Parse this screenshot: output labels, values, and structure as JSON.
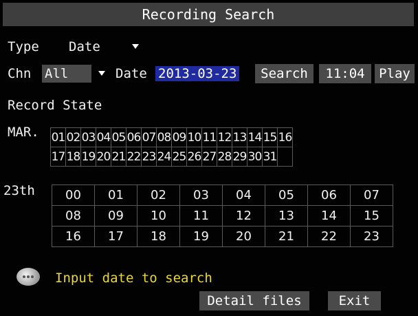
{
  "title": "Recording Search",
  "type_row": {
    "label": "Type",
    "value": "Date"
  },
  "filter_row": {
    "chn_label": "Chn",
    "chn_value": "All",
    "date_label": "Date",
    "date_value": "2013-03-23",
    "search_label": "Search",
    "time_value": "11:04",
    "play_label": "Play"
  },
  "record_state_label": "Record State",
  "month": {
    "label": "MAR.",
    "days": [
      "01",
      "02",
      "03",
      "04",
      "05",
      "06",
      "07",
      "08",
      "09",
      "10",
      "11",
      "12",
      "13",
      "14",
      "15",
      "16",
      "17",
      "18",
      "19",
      "20",
      "21",
      "22",
      "23",
      "24",
      "25",
      "26",
      "27",
      "28",
      "29",
      "30",
      "31",
      ""
    ]
  },
  "hours": {
    "label": "23th",
    "values": [
      "00",
      "01",
      "02",
      "03",
      "04",
      "05",
      "06",
      "07",
      "08",
      "09",
      "10",
      "11",
      "12",
      "13",
      "14",
      "15",
      "16",
      "17",
      "18",
      "19",
      "20",
      "21",
      "22",
      "23"
    ]
  },
  "hint": {
    "text": "Input date to search",
    "icon": "speech-bubble-icon"
  },
  "buttons": {
    "detail_files": "Detail files",
    "exit": "Exit"
  },
  "colors": {
    "date_highlight": "#1f2b9e",
    "hint_text": "#e8d838",
    "title_bar": "#3e3e3e"
  }
}
